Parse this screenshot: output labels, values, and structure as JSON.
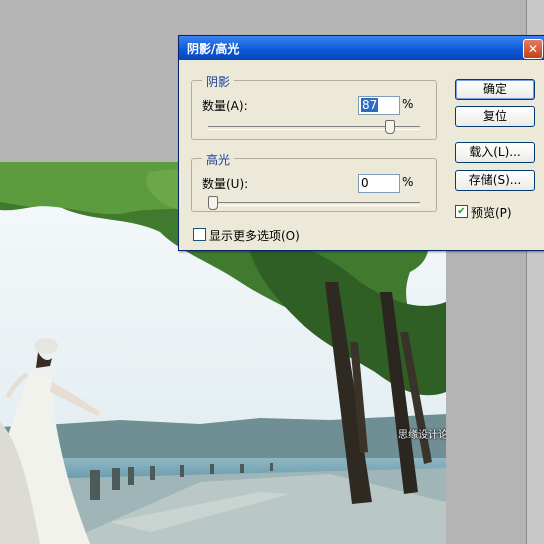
{
  "dialog": {
    "title": "阴影/高光",
    "close_glyph": "✕",
    "shadows": {
      "group_label": "阴影",
      "amount_label": "数量(A):",
      "amount_value": "87",
      "amount_unit": "%",
      "slider_fraction": 0.87
    },
    "highlights": {
      "group_label": "高光",
      "amount_label": "数量(U):",
      "amount_value": "0",
      "amount_unit": "%",
      "slider_fraction": 0.0
    },
    "more_options": {
      "label": "显示更多选项(O)",
      "checked": false
    },
    "buttons": {
      "ok": "确定",
      "reset": "复位",
      "load": "载入(L)...",
      "save": "存储(S)..."
    },
    "preview": {
      "label": "预览(P)",
      "checked": true,
      "check_glyph": "✔"
    }
  },
  "watermark": "思缘设计论坛 WWW.MISSYUAN.COM",
  "colors": {
    "titlebar": "#0b57d8",
    "dialog_bg": "#ece9d8",
    "workspace": "#b4b4b4",
    "group_title": "#1a3f9a"
  }
}
